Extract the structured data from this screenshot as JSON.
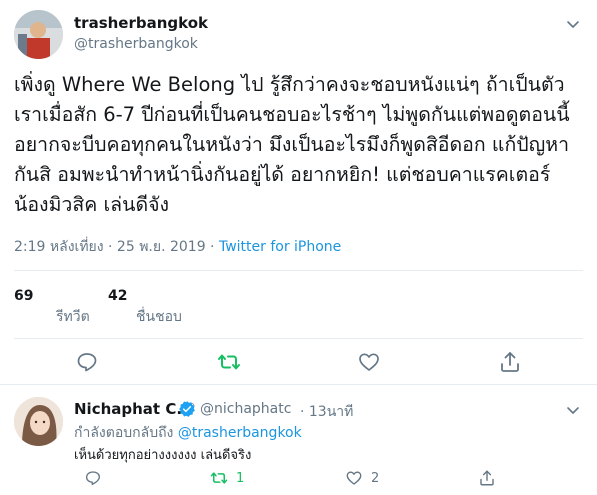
{
  "tweet": {
    "author_name": "trasherbangkok",
    "author_handle": "@trasherbangkok",
    "text": "เพิ่งดู Where We Belong ไป รู้สึกว่าคงจะชอบหนังแน่ๆ ถ้าเป็นตัวเราเมื่อสัก 6-7 ปีก่อนที่เป็นคนชอบอะไรช้าๆ ไม่พูดกันแต่พอดูตอนนี้อยากจะบีบคอทุกคนในหนังว่า มึงเป็นอะไรมึงก็พูดสิอีดอก แก้ปัญหากันสิ อมพะนำทำหน้านิ่งกันอยู่ได้ อยากหยิก! แต่ชอบคาแรคเตอร์น้องมิวสิค เล่นดีจัง",
    "timestamp": "2:19 หลังเที่ยง · 25 พ.ย. 2019 · ",
    "source": "Twitter for iPhone",
    "retweets_count": "69",
    "retweets_label": "รีทวีต",
    "likes_count": "42",
    "likes_label": "ชื่นชอบ"
  },
  "actions": {
    "reply_icon": "reply-icon",
    "retweet_icon": "retweet-icon",
    "like_icon": "heart-icon",
    "share_icon": "share-icon",
    "retweet_color": "#17bf63"
  },
  "reply": {
    "author_name": "Nichaphat C.♡",
    "author_handle": "@nichaphatc",
    "time": "· 13นาที",
    "replying_to_prefix": "กำลังตอบกลับถึง ",
    "replying_to_mention": "@trasherbangkok",
    "text": "เห็นด้วยทุกอย่างงงงงง เล่นดีจริง",
    "retweet_count": "1",
    "like_count": "2"
  },
  "colors": {
    "accent": "#1b95e0",
    "muted": "#657786",
    "divider": "#e6ecf0"
  }
}
